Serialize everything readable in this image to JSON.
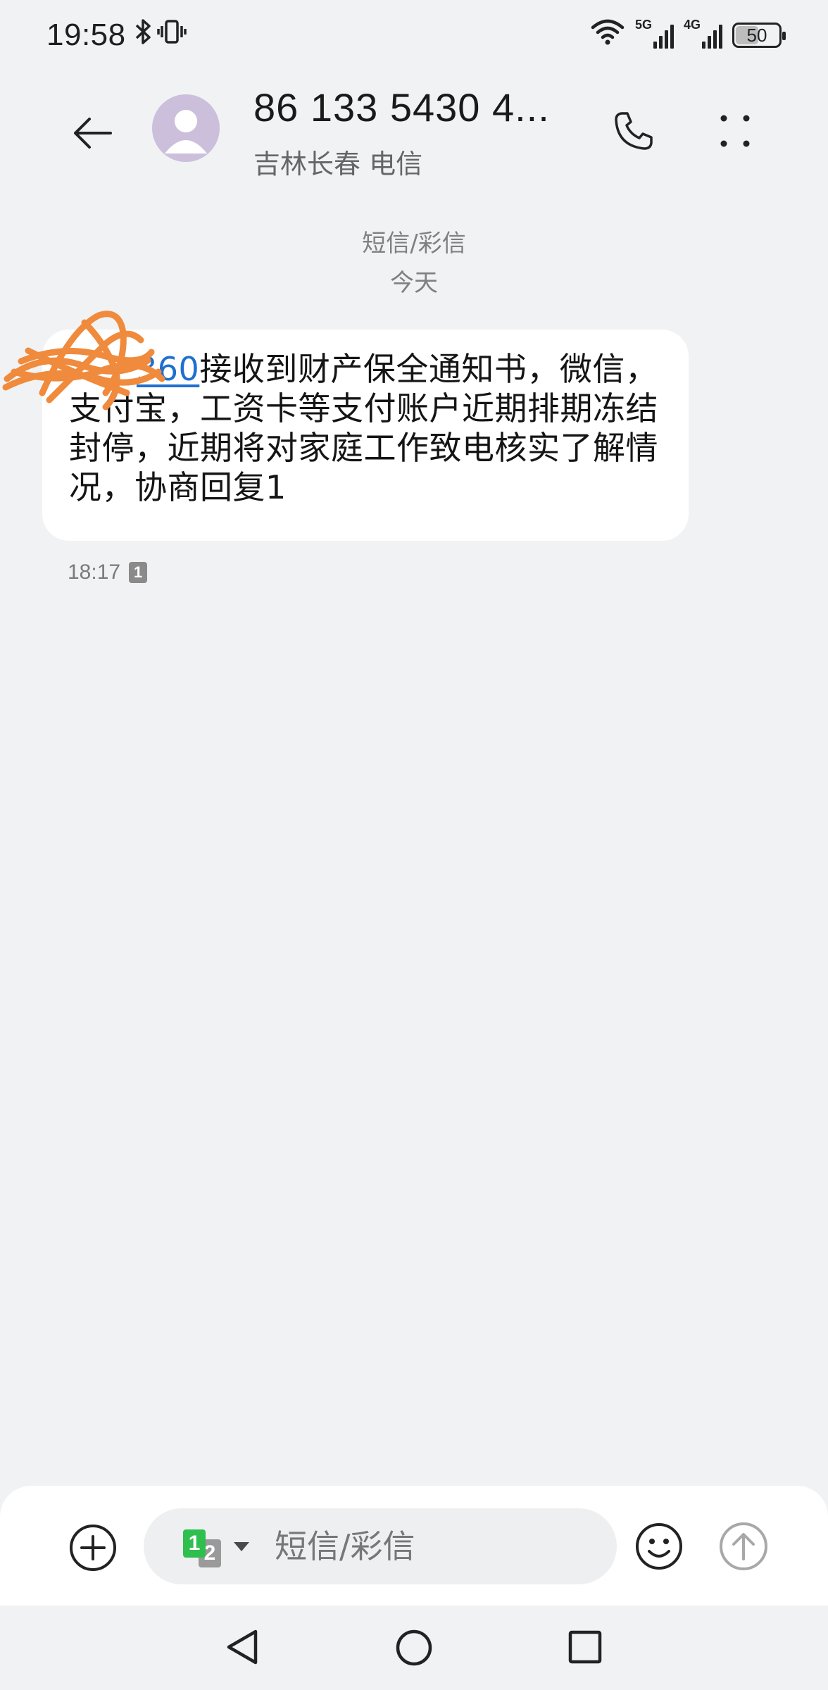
{
  "status_bar": {
    "time": "19:58",
    "icons": [
      "bluetooth-icon",
      "vibrate-icon",
      "wifi-icon",
      "signal-5g-icon",
      "signal-4g-icon",
      "battery-icon"
    ],
    "signal1_label": "5G",
    "signal2_label": "4G",
    "battery_level": "50",
    "battery_fraction": 0.5
  },
  "header": {
    "contact_name": "86 133 5430 4...",
    "contact_location": "吉林长春 电信",
    "icons": [
      "back-arrow-icon",
      "contact-avatar-icon",
      "phone-call-icon",
      "more-vertical-icon"
    ]
  },
  "conversation": {
    "type_label": "短信/彩信",
    "date_label": "今天",
    "message": {
      "prefix": "",
      "link": "360",
      "body": "接收到财产保全通知书，微信，支付宝，工资卡等支付账户近期排期冻结封停，近期将对家庭工作致电核实了解情况，协商回复1",
      "time": "18:17",
      "sim_badge": "1"
    }
  },
  "composer": {
    "placeholder": "短信/彩信",
    "sim_primary": "1",
    "sim_secondary": "2",
    "icons": [
      "add-attachment-icon",
      "sim-switch-icon",
      "emoji-icon",
      "send-icon"
    ]
  },
  "navigation": {
    "icons": [
      "nav-back-icon",
      "nav-home-icon",
      "nav-recents-icon"
    ]
  },
  "colors": {
    "background": "#f1f2f4",
    "bubble": "#ffffff",
    "link": "#1f6fd1",
    "sim1": "#2fbf4f",
    "scribble": "#f08a3c"
  }
}
